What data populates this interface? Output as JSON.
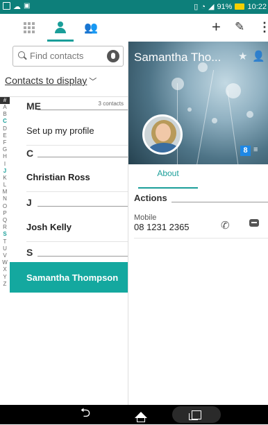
{
  "status_bar": {
    "battery_percent": "91%",
    "time": "10:22",
    "icons": [
      "screen-icon",
      "cloud-icon",
      "image-icon",
      "vibrate-icon",
      "wifi-icon",
      "signal-icon",
      "battery-icon"
    ]
  },
  "top_bar": {
    "tabs": [
      {
        "name": "apps-grid-icon",
        "active": false
      },
      {
        "name": "contacts-person-icon",
        "active": true
      },
      {
        "name": "groups-icon",
        "active": false
      }
    ],
    "actions": [
      "add-icon",
      "edit-icon",
      "overflow-menu-icon"
    ]
  },
  "left_pane": {
    "search_placeholder": "Find contacts",
    "contacts_to_display": "Contacts to display",
    "alphabet": [
      "#",
      "A",
      "B",
      "C",
      "D",
      "E",
      "F",
      "G",
      "H",
      "I",
      "J",
      "K",
      "L",
      "M",
      "N",
      "O",
      "P",
      "Q",
      "R",
      "S",
      "T",
      "U",
      "V",
      "W",
      "X",
      "Y",
      "Z"
    ],
    "highlighted_letters": [
      "C",
      "J",
      "S"
    ],
    "sections": [
      {
        "letter": "ME",
        "count": "3 contacts",
        "items": [
          "Set up my profile"
        ]
      },
      {
        "letter": "C",
        "count": "",
        "items": [
          "Christian Ross"
        ]
      },
      {
        "letter": "J",
        "count": "",
        "items": [
          "Josh Kelly"
        ]
      },
      {
        "letter": "S",
        "count": "",
        "items": [
          "Samantha Thompson"
        ]
      }
    ],
    "selected_contact": "Samantha Thompson"
  },
  "right_pane": {
    "contact_name": "Samantha Tho...",
    "header_icons": [
      "star-icon",
      "person-settings-icon"
    ],
    "badges": {
      "google": "8",
      "list": "≡"
    },
    "tab_about": "About",
    "actions_label": "Actions",
    "mobile_label": "Mobile",
    "mobile_number": "08 1231 2365"
  },
  "colors": {
    "accent": "#1a9e99",
    "selected_row": "#14a89f",
    "status_bar": "#0d7f7a"
  }
}
